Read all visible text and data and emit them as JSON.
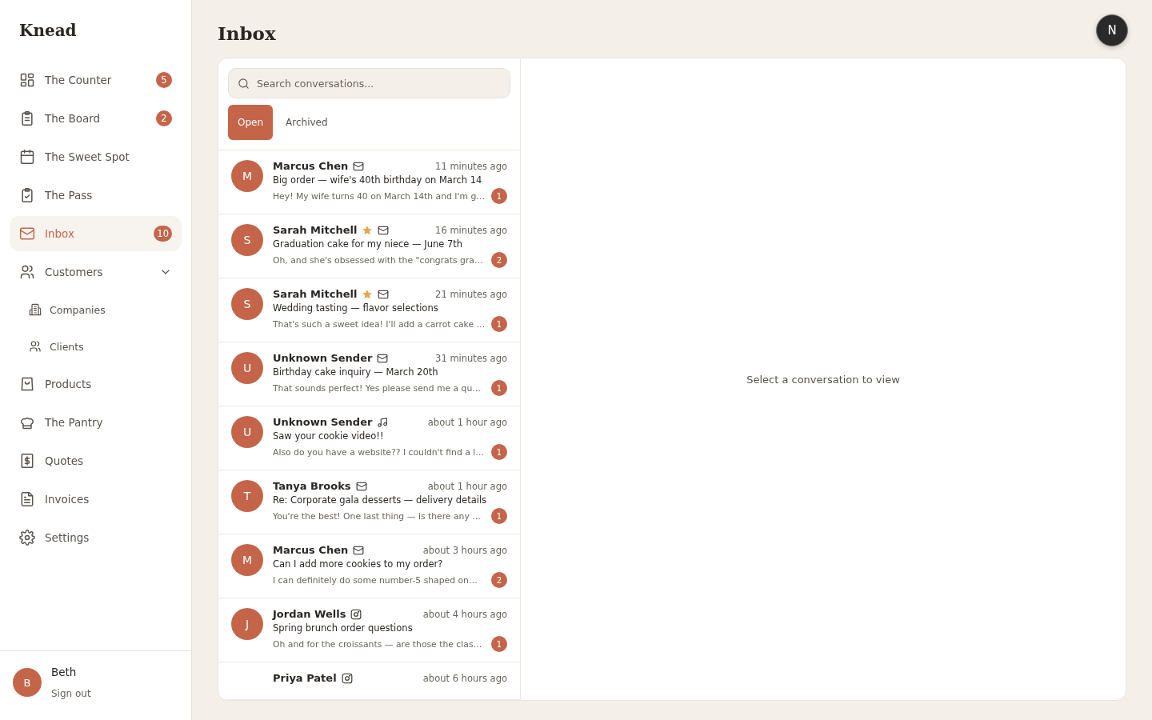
{
  "brand": "Knead",
  "nav": [
    {
      "label": "The Counter",
      "badge": "5",
      "selected": false
    },
    {
      "label": "The Board",
      "badge": "2",
      "selected": false
    },
    {
      "label": "The Sweet Spot",
      "selected": false
    },
    {
      "label": "The Pass",
      "selected": false
    },
    {
      "label": "Inbox",
      "badge": "10",
      "selected": true
    },
    {
      "label": "Customers",
      "selected": false,
      "expanded": true,
      "children": [
        {
          "label": "Companies",
          "selected": false
        },
        {
          "label": "Clients",
          "selected": false
        }
      ]
    },
    {
      "label": "Products",
      "selected": false
    },
    {
      "label": "The Pantry",
      "selected": false
    },
    {
      "label": "Quotes",
      "selected": false
    },
    {
      "label": "Invoices",
      "selected": false
    },
    {
      "label": "Settings",
      "selected": false
    }
  ],
  "user": {
    "initial": "B",
    "name": "Beth",
    "signout": "Sign out"
  },
  "page_title": "Inbox",
  "account_initial": "N",
  "search": {
    "placeholder": "Search conversations..."
  },
  "tabs": [
    {
      "label": "Open",
      "selected": true
    },
    {
      "label": "Archived",
      "selected": false
    }
  ],
  "conversations": [
    {
      "initial": "M",
      "name": "Marcus Chen",
      "starred": false,
      "kind": "email",
      "time": "11 minutes ago",
      "subject": "Big order — wife's 40th birthday on March 14",
      "preview": "Hey! My wife turns 40 on March 14th and I'm g…",
      "unread": "1"
    },
    {
      "initial": "S",
      "name": "Sarah Mitchell",
      "starred": true,
      "kind": "email",
      "time": "16 minutes ago",
      "subject": "Graduation cake for my niece — June 7th",
      "preview": "Oh, and she's obsessed with the \"congrats gra…",
      "unread": "2"
    },
    {
      "initial": "S",
      "name": "Sarah Mitchell",
      "starred": true,
      "kind": "email",
      "time": "21 minutes ago",
      "subject": "Wedding tasting — flavor selections",
      "preview": "That's such a sweet idea! I'll add a carrot cake …",
      "unread": "1"
    },
    {
      "initial": "U",
      "name": "Unknown Sender",
      "starred": false,
      "kind": "email",
      "time": "31 minutes ago",
      "subject": "Birthday cake inquiry — March 20th",
      "preview": "That sounds perfect! Yes please send me a qu…",
      "unread": "1"
    },
    {
      "initial": "U",
      "name": "Unknown Sender",
      "starred": false,
      "kind": "music",
      "time": "about 1 hour ago",
      "subject": "Saw your cookie video!!",
      "preview": "Also do you have a website?? I couldn't find a l…",
      "unread": "1"
    },
    {
      "initial": "T",
      "name": "Tanya Brooks",
      "starred": false,
      "kind": "email",
      "time": "about 1 hour ago",
      "subject": "Re: Corporate gala desserts — delivery details",
      "preview": "You're the best! One last thing — is there any …",
      "unread": "1"
    },
    {
      "initial": "M",
      "name": "Marcus Chen",
      "starred": false,
      "kind": "email",
      "time": "about 3 hours ago",
      "subject": "Can I add more cookies to my order?",
      "preview": "I can definitely do some number-5 shaped on…",
      "unread": "2"
    },
    {
      "initial": "J",
      "name": "Jordan Wells",
      "starred": false,
      "kind": "instagram",
      "time": "about 4 hours ago",
      "subject": "Spring brunch order questions",
      "preview": "Oh and for the croissants — are those the clas…",
      "unread": "1"
    },
    {
      "name": "Priya Patel",
      "starred": false,
      "kind": "instagram",
      "time": "about 6 hours ago"
    }
  ],
  "empty_state": "Select a conversation to view"
}
